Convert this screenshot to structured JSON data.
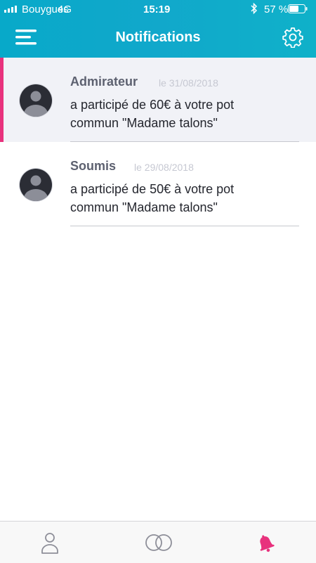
{
  "status_bar": {
    "carrier": "Bouygues",
    "network": "4G",
    "time": "15:19",
    "battery": "57 %"
  },
  "header": {
    "title": "Notifications",
    "color": "#0ba9c9"
  },
  "notifications": [
    {
      "name": "Admirateur",
      "date": "le 31/08/2018",
      "message": "a participé de 60€ à votre pot commun \"Madame talons\"",
      "unread": true
    },
    {
      "name": "Soumis",
      "date": "le 29/08/2018",
      "message": "a participé de 50€ à votre pot commun \"Madame talons\"",
      "unread": false
    }
  ],
  "tab_bar": {
    "items": [
      {
        "icon": "profile-icon",
        "active": false
      },
      {
        "icon": "rings-icon",
        "active": false
      },
      {
        "icon": "bell-icon",
        "active": true
      }
    ],
    "active_color": "#e8327d",
    "inactive_color": "#8e8f99"
  }
}
